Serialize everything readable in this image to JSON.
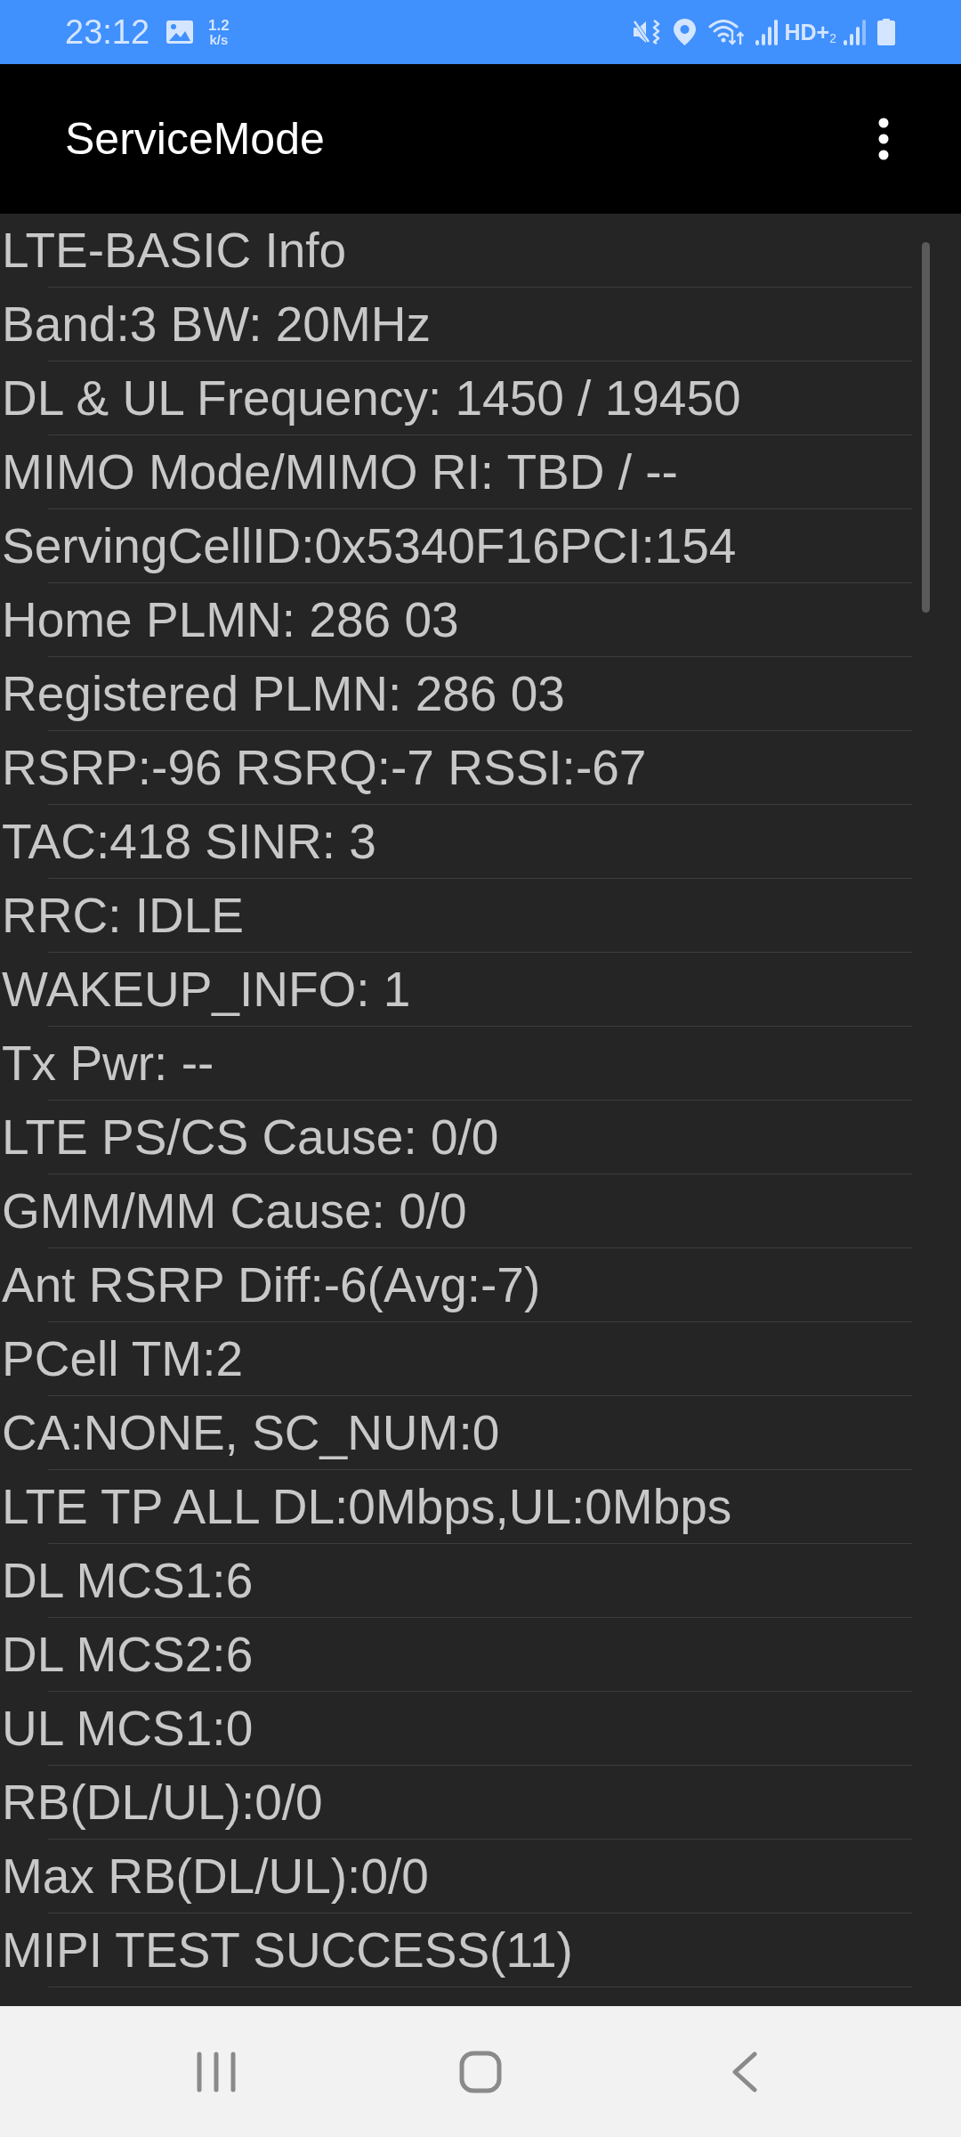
{
  "status_bar": {
    "time": "23:12",
    "speed": {
      "value": "1.2",
      "unit": "k/s"
    },
    "network_label": "HD+$_{2}$"
  },
  "app_bar": {
    "title": "ServiceMode"
  },
  "list": {
    "rows": [
      "LTE-BASIC Info",
      "Band:3 BW: 20MHz",
      "DL & UL Frequency: 1450 / 19450",
      "MIMO Mode/MIMO RI: TBD / --",
      "ServingCellID:0x5340F16PCI:154",
      "Home PLMN: 286 03",
      "Registered PLMN: 286 03",
      "RSRP:-96 RSRQ:-7 RSSI:-67",
      "TAC:418 SINR: 3",
      "RRC: IDLE",
      "WAKEUP_INFO: 1",
      "Tx Pwr: --",
      "LTE PS/CS Cause: 0/0",
      "GMM/MM Cause: 0/0",
      "Ant RSRP Diff:-6(Avg:-7)",
      "PCell TM:2",
      "CA:NONE, SC_NUM:0",
      "LTE TP ALL DL:0Mbps,UL:0Mbps",
      "DL MCS1:6",
      "DL MCS2:6",
      "UL MCS1:0",
      "RB(DL/UL):0/0",
      "Max RB(DL/UL):0/0",
      "MIPI TEST SUCCESS(11)"
    ]
  }
}
